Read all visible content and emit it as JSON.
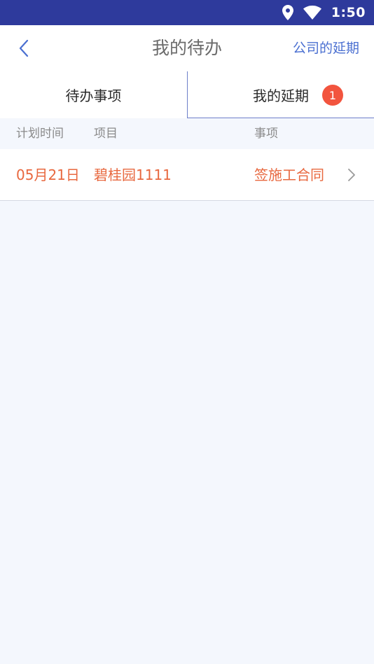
{
  "status_bar": {
    "time": "1:50",
    "icons": [
      "location-icon",
      "wifi-icon"
    ],
    "background": "#2e3a9c"
  },
  "nav": {
    "back_icon": "chevron-left-icon",
    "title": "我的待办",
    "action_label": "公司的延期"
  },
  "tabs": [
    {
      "label": "待办事项",
      "active": false
    },
    {
      "label": "我的延期",
      "active": true,
      "badge": "1"
    }
  ],
  "table": {
    "columns": [
      "计划时间",
      "项目",
      "事项"
    ],
    "rows": [
      {
        "time": "05月21日",
        "project": "碧桂园1111",
        "item": "签施工合同",
        "icon": "chevron-right-icon"
      }
    ]
  },
  "colors": {
    "accent": "#4a6fd1",
    "highlight_text": "#e8683f",
    "badge": "#f2543e",
    "page_background": "#f4f7fd"
  }
}
